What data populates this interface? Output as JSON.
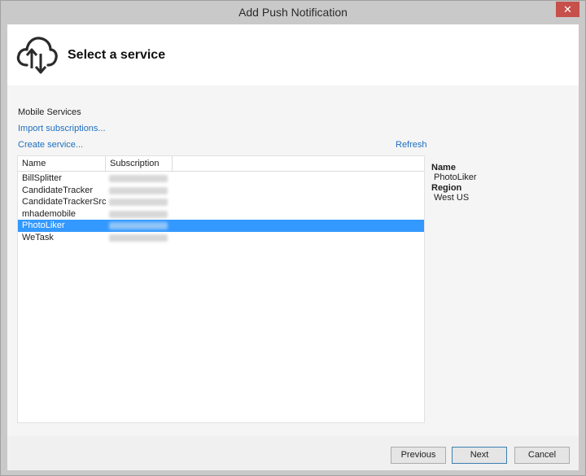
{
  "window": {
    "title": "Add Push Notification",
    "close_glyph": "✕"
  },
  "header": {
    "icon": "cloud-up-down-icon",
    "title": "Select a service"
  },
  "section": {
    "label": "Mobile Services",
    "import_link": "Import subscriptions...",
    "create_link": "Create service...",
    "refresh_link": "Refresh"
  },
  "list": {
    "columns": [
      "Name",
      "Subscription"
    ],
    "rows": [
      {
        "name": "BillSplitter",
        "selected": false
      },
      {
        "name": "CandidateTracker",
        "selected": false
      },
      {
        "name": "CandidateTrackerSrc",
        "selected": false
      },
      {
        "name": "mhademobile",
        "selected": false
      },
      {
        "name": "PhotoLiker",
        "selected": true
      },
      {
        "name": "WeTask",
        "selected": false
      }
    ]
  },
  "details": {
    "name_label": "Name",
    "name_value": "PhotoLiker",
    "region_label": "Region",
    "region_value": "West US"
  },
  "footer": {
    "previous": "Previous",
    "next": "Next",
    "cancel": "Cancel"
  },
  "colors": {
    "selection": "#3399ff",
    "link": "#1e6fbf",
    "close": "#c7504a"
  }
}
